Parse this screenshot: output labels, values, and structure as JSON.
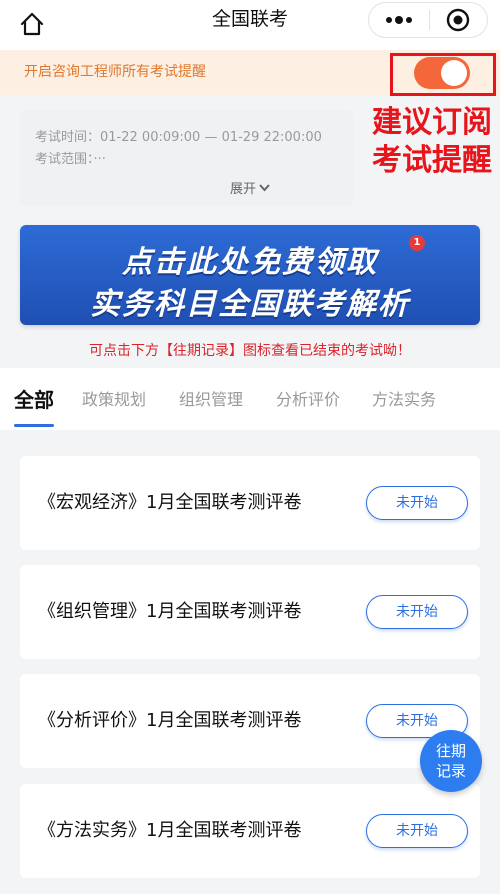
{
  "header": {
    "title": "全国联考",
    "home_icon": "home-icon",
    "more_icon": "more-dots-icon",
    "target_icon": "target-icon"
  },
  "subscribe": {
    "label": "开启咨询工程师所有考试提醒",
    "toggle_on": true,
    "annotation": "建议订阅考试提醒",
    "annotation_color": "#e8141b"
  },
  "exam_info": {
    "time_label": "考试时间：",
    "time_value": "01-22 00:09:00 — 01-29 22:00:00",
    "scope_label": "考试范围：",
    "scope_value": "···",
    "expand_label": "展开"
  },
  "banner": {
    "line1": "点击此处免费领取",
    "line2": "实务科目全国联考解析",
    "badge": "1"
  },
  "tip": "可点击下方【往期记录】图标查看已结束的考试呦！",
  "tabs": [
    {
      "label": "全部",
      "active": true
    },
    {
      "label": "政策规划",
      "active": false
    },
    {
      "label": "组织管理",
      "active": false
    },
    {
      "label": "分析评价",
      "active": false
    },
    {
      "label": "方法实务",
      "active": false
    }
  ],
  "exams": [
    {
      "name": "《宏观经济》1月全国联考测评卷",
      "status": "未开始"
    },
    {
      "name": "《组织管理》1月全国联考测评卷",
      "status": "未开始"
    },
    {
      "name": "《分析评价》1月全国联考测评卷",
      "status": "未开始"
    },
    {
      "name": "《方法实务》1月全国联考测评卷",
      "status": "未开始"
    }
  ],
  "history_button": {
    "line1": "往期",
    "line2": "记录"
  },
  "colors": {
    "accent": "#2d6fe0",
    "toggle": "#f3673a",
    "subscribe_text": "#e0782f",
    "tip": "#d9242b"
  }
}
